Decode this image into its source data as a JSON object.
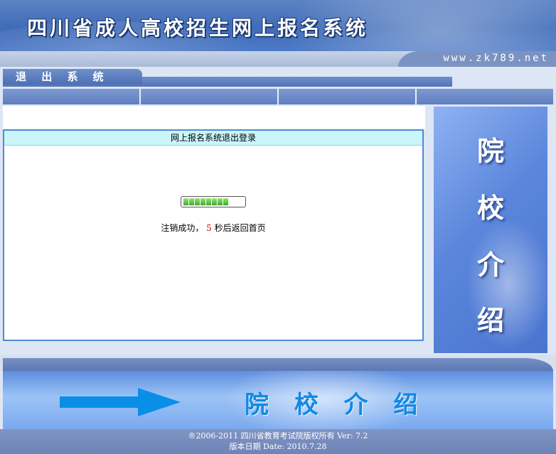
{
  "header": {
    "title": "四川省成人高校招生网上报名系统",
    "url": "www.zk789.net"
  },
  "nav": {
    "logout_label": "退 出 系 统",
    "menu_cells": [
      "",
      "",
      "",
      ""
    ]
  },
  "main": {
    "panel_title": "网上报名系统退出登录",
    "progress_segments": 8,
    "status_prefix": "注销成功，",
    "countdown": "5",
    "status_suffix": "秒后返回首页"
  },
  "side_banner": {
    "chars": [
      "院",
      "校",
      "介",
      "绍"
    ]
  },
  "footer": {
    "heading": "院 校 介 绍",
    "copyright": "®2006-2011 四川省教育考试院版权所有   Ver: 7.2",
    "version_date": "版本日期  Date: 2010.7.28"
  },
  "colors": {
    "accent": "#4d8ad9",
    "countdown": "#d40000",
    "footer_heading": "#1389e0"
  }
}
